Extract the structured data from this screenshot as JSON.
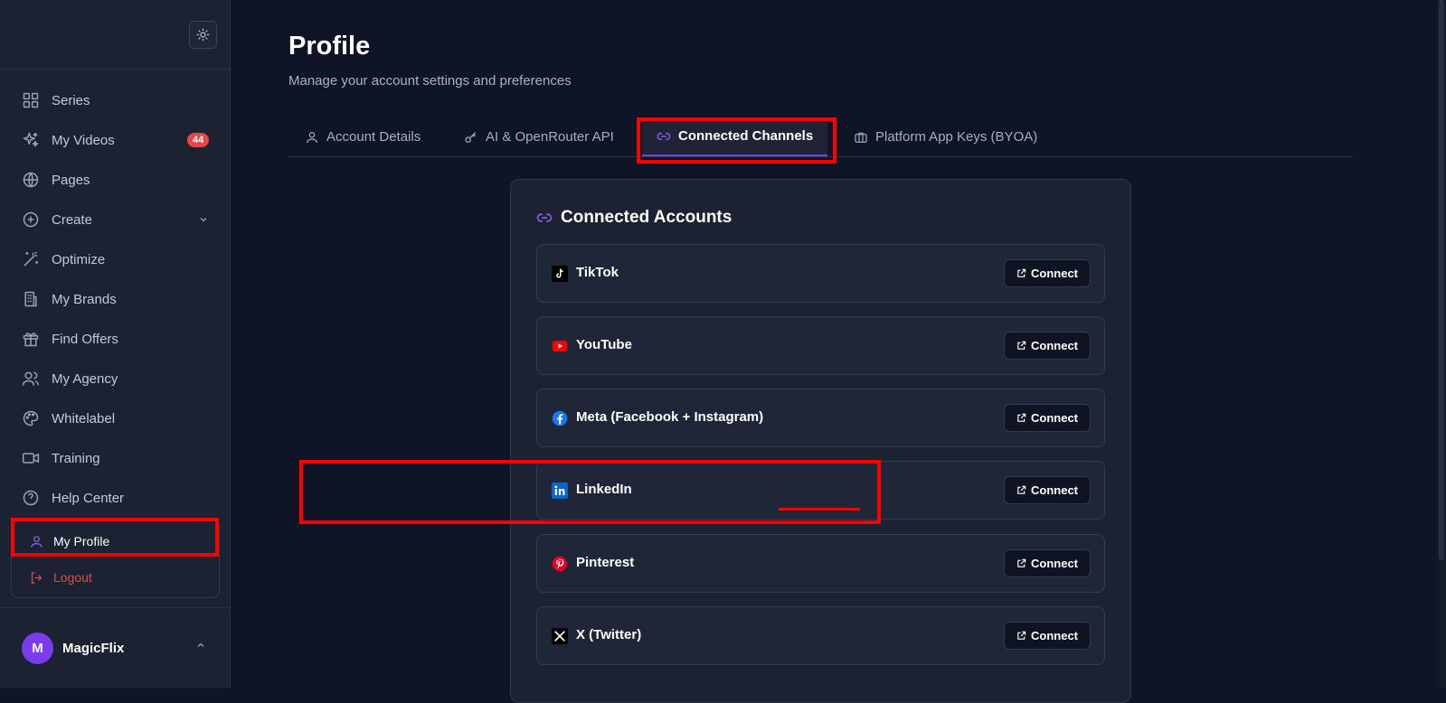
{
  "sidebar": {
    "items": [
      {
        "label": "Series",
        "icon": "grid-icon"
      },
      {
        "label": "My Videos",
        "icon": "sparkles-icon",
        "badge": "44"
      },
      {
        "label": "Pages",
        "icon": "globe-icon"
      },
      {
        "label": "Create",
        "icon": "plus-circle-icon"
      },
      {
        "label": "Optimize",
        "icon": "wand-icon"
      },
      {
        "label": "My Brands",
        "icon": "building-icon"
      },
      {
        "label": "Find Offers",
        "icon": "gift-icon"
      },
      {
        "label": "My Agency",
        "icon": "users-icon"
      },
      {
        "label": "Whitelabel",
        "icon": "palette-icon"
      },
      {
        "label": "Training",
        "icon": "video-icon"
      },
      {
        "label": "Help Center",
        "icon": "help-icon"
      }
    ],
    "menu": {
      "profile": "My Profile",
      "logout": "Logout"
    },
    "user": {
      "initial": "M",
      "name": "MagicFlix"
    }
  },
  "page": {
    "title": "Profile",
    "subtitle": "Manage your account settings and preferences"
  },
  "tabs": [
    {
      "label": "Account Details"
    },
    {
      "label": "AI & OpenRouter API"
    },
    {
      "label": "Connected Channels"
    },
    {
      "label": "Platform App Keys (BYOA)"
    }
  ],
  "card": {
    "title": "Connected Accounts",
    "connect_label": "Connect",
    "accounts": [
      {
        "name": "TikTok"
      },
      {
        "name": "YouTube"
      },
      {
        "name": "Meta (Facebook + Instagram)"
      },
      {
        "name": "LinkedIn"
      },
      {
        "name": "Pinterest"
      },
      {
        "name": "X (Twitter)"
      }
    ]
  },
  "colors": {
    "accent": "#7c3aed",
    "badge": "#ef4444",
    "highlight": "#ff0000",
    "background": "#0f1527",
    "sidebar": "#1b2232"
  }
}
